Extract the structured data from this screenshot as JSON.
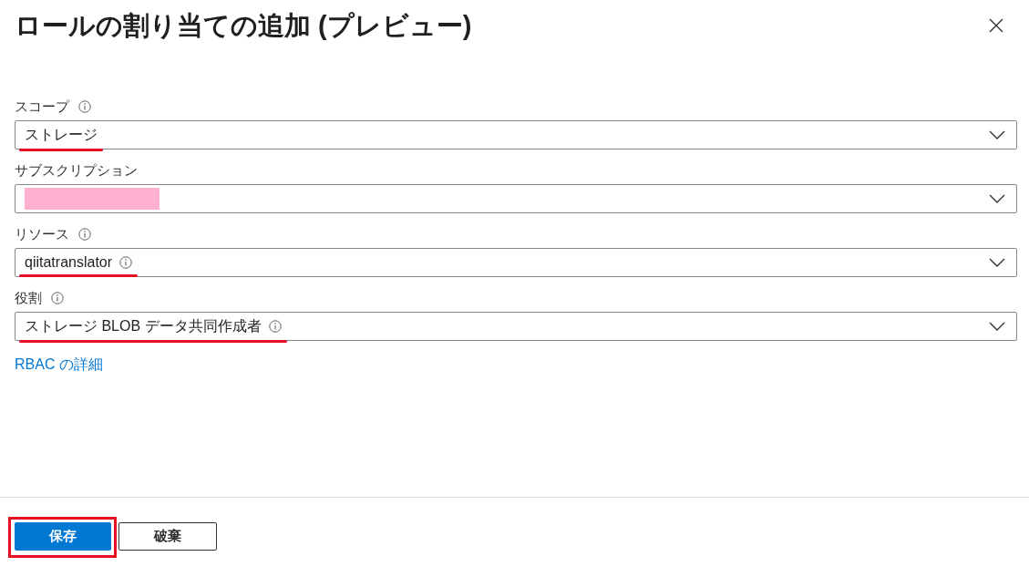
{
  "panel": {
    "title": "ロールの割り当ての追加 (プレビュー)"
  },
  "fields": [
    {
      "label": "スコープ",
      "label_info": true,
      "value": "ストレージ",
      "value_info": false,
      "redacted": false,
      "underlined": true
    },
    {
      "label": "サブスクリプション",
      "label_info": false,
      "value_info": false,
      "redacted": true,
      "underlined": false
    },
    {
      "label": "リソース",
      "label_info": true,
      "value": "qiitatranslator",
      "value_info": true,
      "redacted": false,
      "underlined": true
    },
    {
      "label": "役割",
      "label_info": true,
      "value": "ストレージ BLOB データ共同作成者",
      "value_info": true,
      "redacted": false,
      "underlined": true
    }
  ],
  "link": "RBAC の詳細",
  "buttons": [
    {
      "label": "保存",
      "kind": "primary",
      "highlighted": true
    },
    {
      "label": "破棄",
      "kind": "secondary",
      "highlighted": false
    }
  ]
}
